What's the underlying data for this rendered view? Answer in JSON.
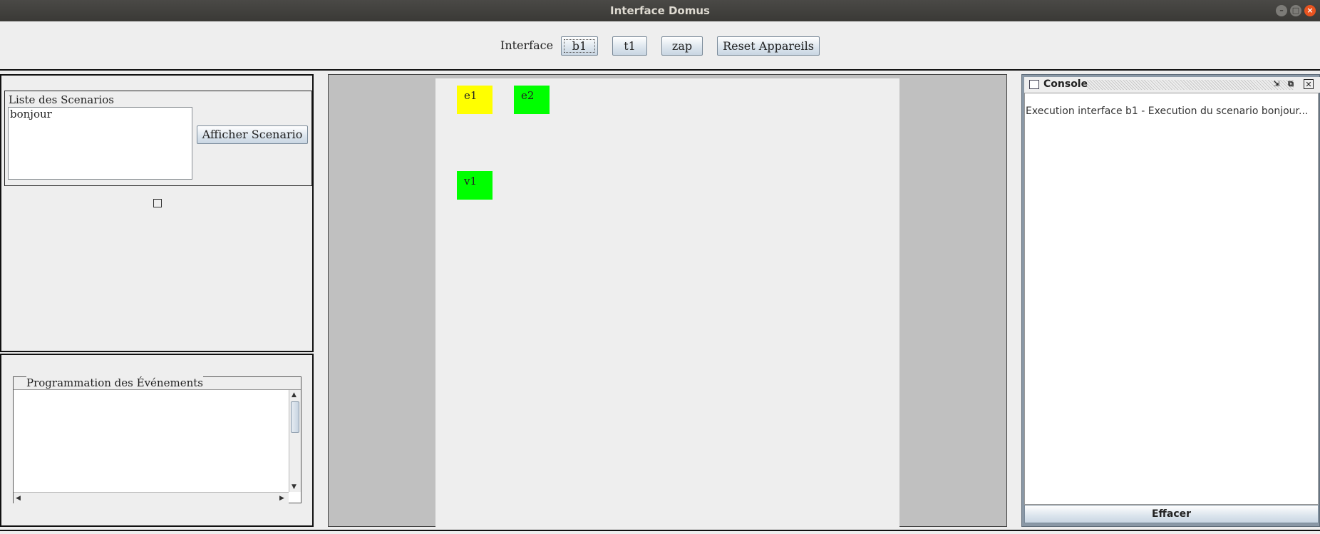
{
  "window": {
    "title": "Interface Domus"
  },
  "toolbar": {
    "label": "Interface",
    "buttons": [
      "b1",
      "t1",
      "zap",
      "Reset Appareils"
    ]
  },
  "scenarios": {
    "legend": "Liste des Scenarios",
    "items": [
      "bonjour"
    ],
    "show_button": "Afficher Scenario"
  },
  "events": {
    "legend": "Programmation des Événements"
  },
  "devices": [
    {
      "label": "e1",
      "color": "#ffff00"
    },
    {
      "label": "e2",
      "color": "#00ff00"
    },
    {
      "label": "v1",
      "color": "#00ff00"
    }
  ],
  "console": {
    "title": "Console",
    "log": "Execution interface b1 - Execution du scenario bonjour...",
    "clear_button": "Effacer"
  }
}
